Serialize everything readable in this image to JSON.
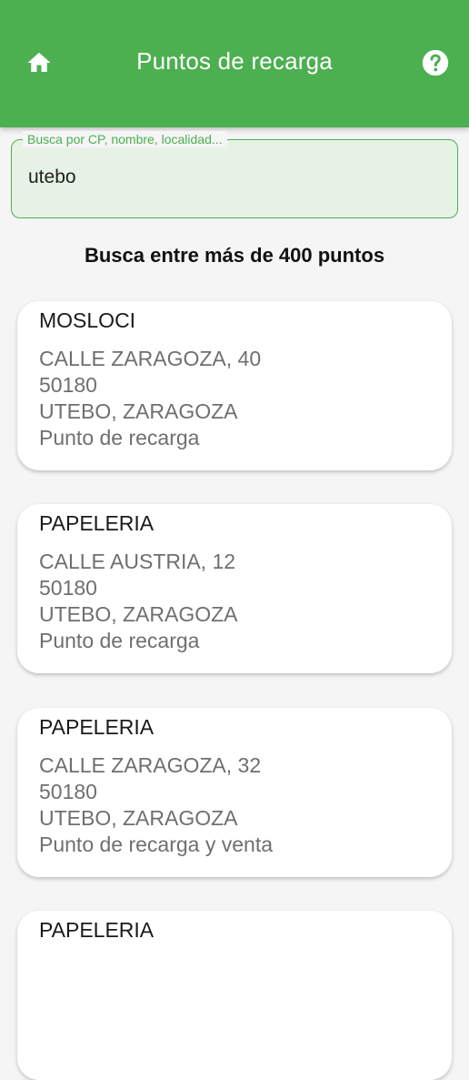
{
  "header": {
    "title": "Puntos de recarga",
    "home_icon": "home-icon",
    "help_icon": "help-circle-icon",
    "background": "#4caf50"
  },
  "search": {
    "label": "Busca por CP, nombre, localidad...",
    "value": "utebo"
  },
  "heading": "Busca entre más de 400 puntos",
  "results": [
    {
      "name": "MOSLOCI",
      "street": "CALLE ZARAGOZA, 40",
      "postal_code": "50180",
      "city": "UTEBO, ZARAGOZA",
      "type": "Punto de recarga"
    },
    {
      "name": "PAPELERIA",
      "street": "CALLE AUSTRIA, 12",
      "postal_code": "50180",
      "city": "UTEBO, ZARAGOZA",
      "type": "Punto de recarga"
    },
    {
      "name": "PAPELERIA",
      "street": "CALLE ZARAGOZA, 32",
      "postal_code": "50180",
      "city": "UTEBO, ZARAGOZA",
      "type": "Punto de recarga y venta"
    },
    {
      "name": "PAPELERIA"
    }
  ]
}
